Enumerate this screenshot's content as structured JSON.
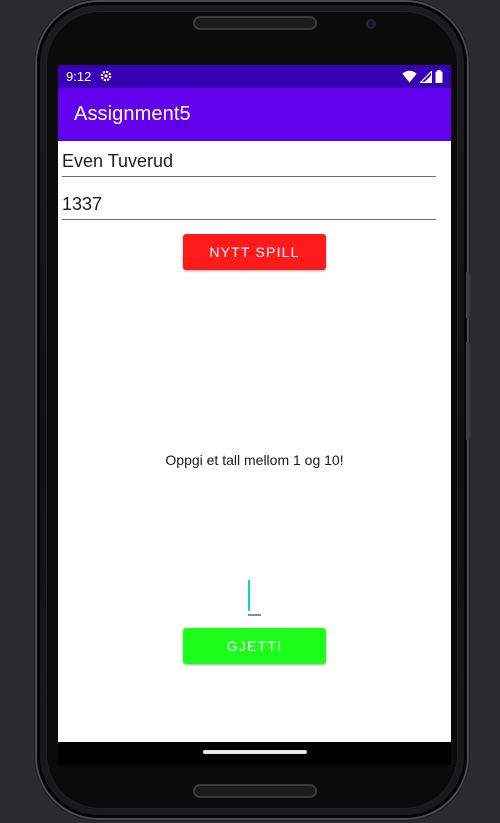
{
  "status_bar": {
    "time": "9:12",
    "icons": [
      "settings-icon",
      "wifi-icon",
      "signal-icon",
      "battery-icon"
    ]
  },
  "app_bar": {
    "title": "Assignment5"
  },
  "form": {
    "name_value": "Even Tuverud",
    "code_value": "1337",
    "new_game_label": "NYTT SPILL",
    "prompt": "Oppgi et tall mellom 1 og 10!",
    "guess_value": "",
    "guess_label": "GJETT!"
  },
  "colors": {
    "status_bar": "#3700b3",
    "app_bar": "#6200ee",
    "new_game_button": "#ff1b1b",
    "guess_button": "#1bff1b",
    "cursor": "#03dac5"
  }
}
